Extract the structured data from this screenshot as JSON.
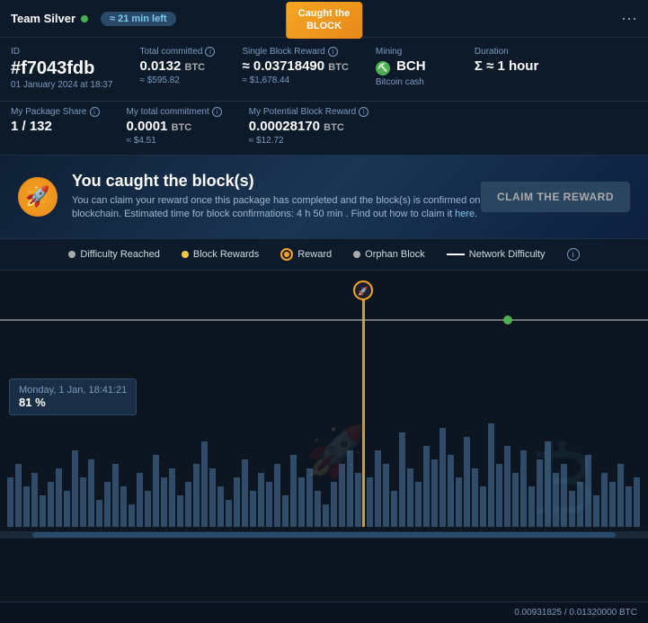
{
  "header": {
    "team": "Team Silver",
    "time_left": "≈ 21 min left",
    "caught_block_label": "Caught the",
    "caught_block_label2": "BLOCK",
    "dots": "···"
  },
  "info_row1": {
    "id_label": "ID",
    "id_value": "#f7043fdb",
    "id_date": "01 January 2024 at 18:37",
    "total_committed_label": "Total committed",
    "total_committed_value": "0.0132",
    "total_committed_unit": "BTC",
    "total_committed_sub": "≈ $595.82",
    "single_block_reward_label": "Single Block Reward",
    "single_block_reward_value": "≈ 0.03718490",
    "single_block_reward_unit": "BTC",
    "single_block_reward_sub": "≈ $1,678.44",
    "mining_label": "Mining",
    "mining_value": "BCH",
    "mining_sub": "Bitcoin cash",
    "duration_label": "Duration",
    "duration_value": "Σ ≈ 1 hour"
  },
  "info_row2": {
    "my_package_label": "My Package Share",
    "my_package_value": "1 / 132",
    "my_total_label": "My total commitment",
    "my_total_value": "0.0001",
    "my_total_unit": "BTC",
    "my_total_sub": "≈ $4.51",
    "my_potential_label": "My Potential Block Reward",
    "my_potential_value": "0.00028170",
    "my_potential_unit": "BTC",
    "my_potential_sub": "≈ $12.72"
  },
  "banner": {
    "title": "You caught the block(s)",
    "description": "You can claim your reward once this package has completed and the block(s) is confirmed on the blockchain. Estimated time for block confirmations: 4 h 50 min . Find out how to claim it",
    "link_text": "here.",
    "claim_button": "CLAIM THE REWARD"
  },
  "legend": {
    "items": [
      {
        "label": "Difficulty Reached",
        "color": "#aaa",
        "type": "dot"
      },
      {
        "label": "Block Rewards",
        "color": "#f5c842",
        "type": "dot"
      },
      {
        "label": "Reward",
        "color": "#f5a623",
        "type": "dot-circle"
      },
      {
        "label": "Orphan Block",
        "color": "#aaa",
        "type": "dot"
      },
      {
        "label": "Network Difficulty",
        "color": "#fff",
        "type": "line"
      }
    ]
  },
  "chart": {
    "tooltip_date": "Monday, 1 Jan, 18:41:21",
    "tooltip_value": "81 %"
  },
  "footer": {
    "progress": "0.00931825 / 0.01320000 BTC"
  }
}
